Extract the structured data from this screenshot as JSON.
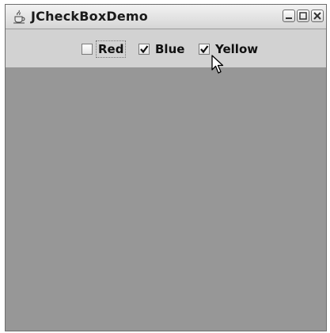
{
  "window": {
    "title": "JCheckBoxDemo",
    "icon": "java-cup-icon",
    "controls": [
      "minimize-icon",
      "maximize-icon",
      "close-icon"
    ]
  },
  "checkboxes": [
    {
      "label": "Red",
      "checked": false,
      "focused": true
    },
    {
      "label": "Blue",
      "checked": true,
      "focused": false
    },
    {
      "label": "Yellow",
      "checked": true,
      "focused": false
    }
  ],
  "colors": {
    "toolbar": "#d2d2d2",
    "content": "#979797"
  }
}
